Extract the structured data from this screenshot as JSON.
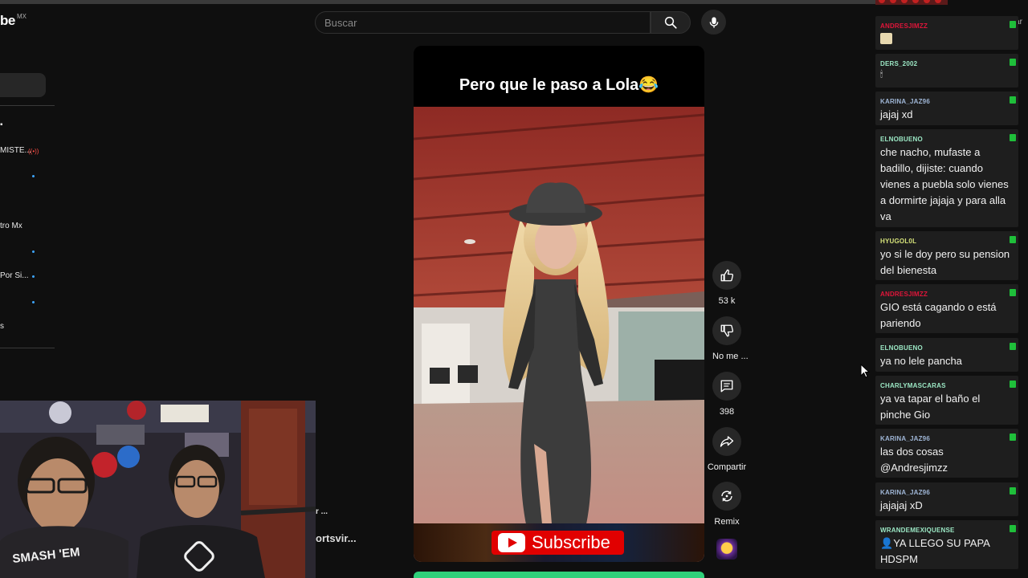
{
  "header": {
    "logo_text": "be",
    "country": "MX",
    "search": {
      "placeholder": "Buscar"
    }
  },
  "sidebar": {
    "items": [
      {
        "label": "MISTE..."
      },
      {
        "label": "tro Mx"
      },
      {
        "label": "Por Si..."
      },
      {
        "label": "s"
      }
    ]
  },
  "short": {
    "caption": "Pero que le paso a Lola😂",
    "subscribe_label": "Subscribe",
    "actions": {
      "like_count": "53 k",
      "dislike_label": "No me ...",
      "comment_count": "398",
      "share_label": "Compartir",
      "remix_label": "Remix"
    }
  },
  "webcam": {
    "behind_text_1": "r ...",
    "behind_text_2": "ortsvir..."
  },
  "chat": {
    "clear_label": "Clear",
    "messages": [
      {
        "user": "ANDRESJIMZZ",
        "text": "",
        "user_color": "#e0153a"
      },
      {
        "user": "DERS_2002",
        "text": "",
        "user_color": "#9be7c4"
      },
      {
        "user": "KARINA_JAZ96",
        "text": "jajaj xd",
        "user_color": "#9fb6d6"
      },
      {
        "user": "ELNOBUENO",
        "text": "che nacho, mufaste a badillo, dijiste: cuando vienes a puebla solo vienes a dormirte jajaja y para alla va",
        "user_color": "#9be7c4"
      },
      {
        "user": "HYUGOL0L",
        "text": "yo si le doy pero su pension del bienesta",
        "user_color": "#d6e37a"
      },
      {
        "user": "ANDRESJIMZZ",
        "text": "GIO está cagando o está pariendo",
        "user_color": "#e0153a"
      },
      {
        "user": "ELNOBUENO",
        "text": "ya no lele pancha",
        "user_color": "#9be7c4"
      },
      {
        "user": "CHARLYMASCARAS",
        "text": "ya va tapar el baño el pinche Gio",
        "user_color": "#9be7c4"
      },
      {
        "user": "KARINA_JAZ96",
        "text": "las dos cosas @Andresjimzz",
        "user_color": "#9fb6d6"
      },
      {
        "user": "KARINA_JAZ96",
        "text": "jajajaj xD",
        "user_color": "#9fb6d6"
      },
      {
        "user": "WRANDEMEXIQUENSE",
        "text": "YA LLEGO SU PAPA HDSPM",
        "user_color": "#9be7c4"
      }
    ]
  },
  "colors": {
    "background": "#0f0f0f",
    "subscribe_red": "#e10000",
    "mod_badge": "#1fbf3a",
    "next_short_green": "#2fd07a"
  }
}
